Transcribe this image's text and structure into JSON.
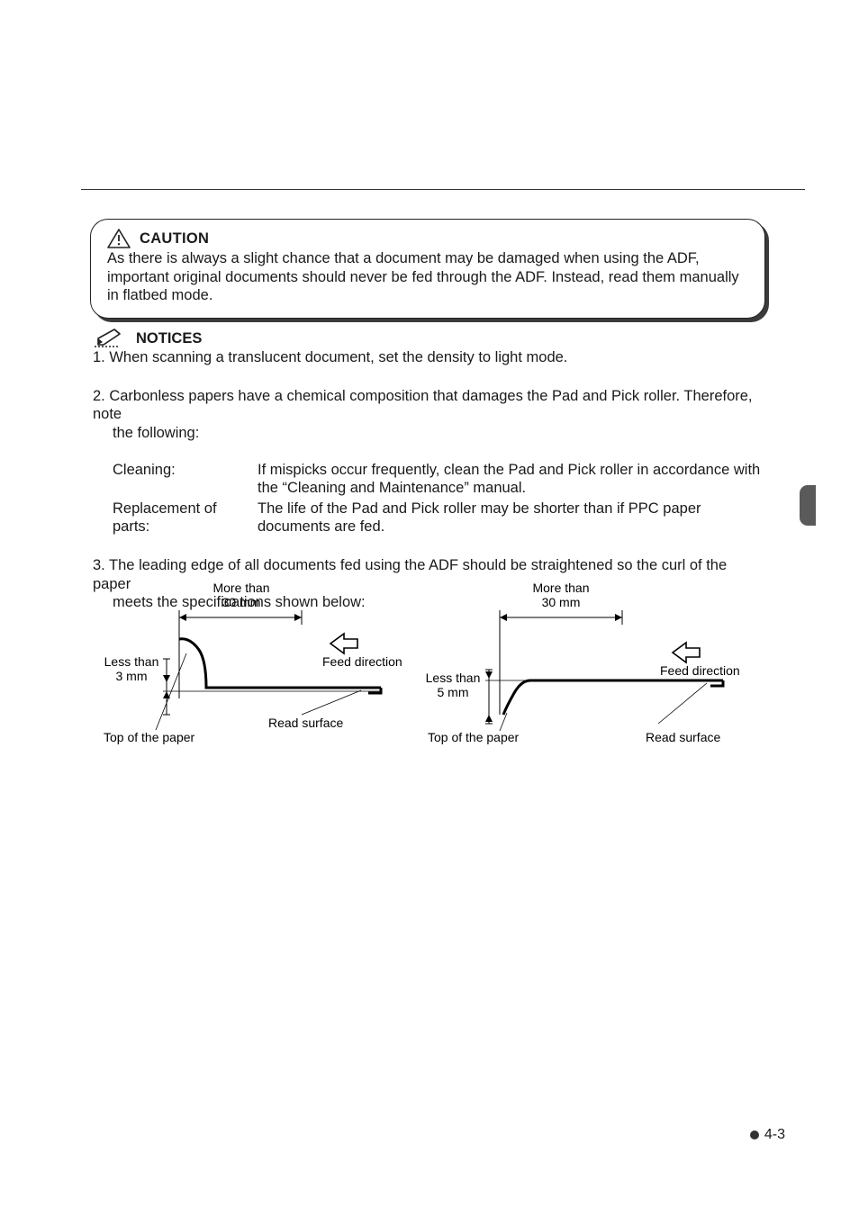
{
  "caution": {
    "label": "CAUTION",
    "body": "As there is always a slight chance that a document may be damaged when using the ADF, important original documents should never be fed through the ADF. Instead, read them manually in flatbed mode."
  },
  "notices": {
    "label": "NOTICES",
    "items": {
      "n1": "1. When scanning a translucent document, set the density to light mode.",
      "n2_first": "2. Carbonless papers have a chemical composition that damages the Pad and Pick roller. Therefore, note",
      "n2_cont": "the following:",
      "cleaning_label": "Cleaning:",
      "cleaning_text": "If mispicks occur frequently, clean the Pad and Pick roller in accordance with the “Cleaning and Maintenance” manual.",
      "replace_label": "Replacement of parts:",
      "replace_text": "The life of the Pad and Pick roller may be shorter than if PPC paper documents are fed.",
      "n3_first": "3. The leading edge of all documents fed using the ADF should be straightened so the curl of the paper",
      "n3_cont": "meets the specifications shown below:"
    }
  },
  "diagram": {
    "more_than_l1": "More than",
    "more_than_l2": "30 mm",
    "feed_direction": "Feed direction",
    "less_than_3_l1": "Less than",
    "less_than_3_l2": "3 mm",
    "less_than_5_l1": "Less than",
    "less_than_5_l2": "5 mm",
    "top_of_paper": "Top of the paper",
    "read_surface": "Read surface"
  },
  "footer": {
    "page": "4-3"
  }
}
